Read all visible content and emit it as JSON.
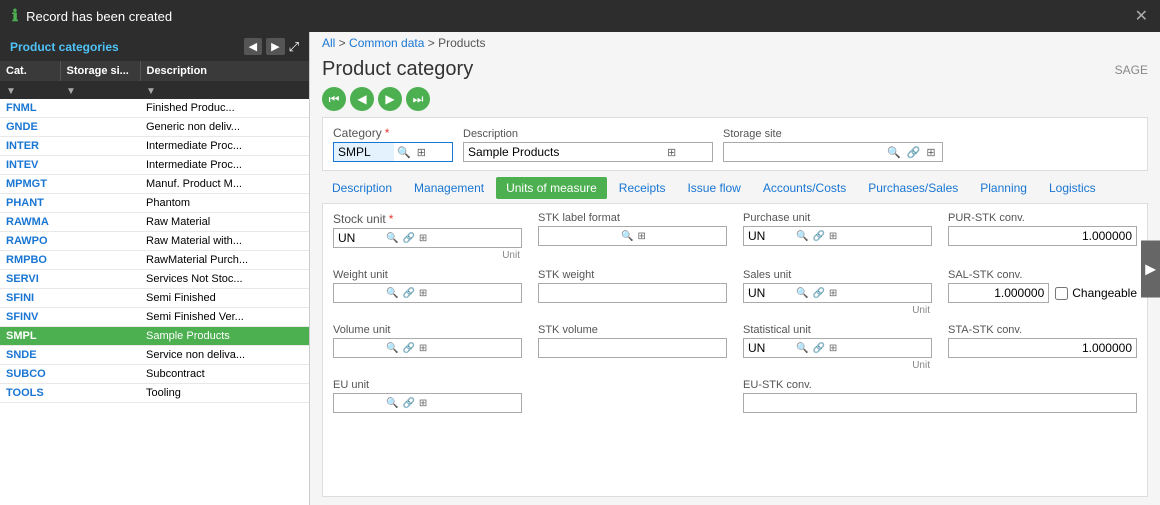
{
  "notification": {
    "icon": "ℹ",
    "text": "Record has been created",
    "close_icon": "✕"
  },
  "left_panel": {
    "title": "Product categories",
    "columns": [
      "Cat.",
      "Storage si...",
      "Description"
    ],
    "rows": [
      {
        "cat": "FNML",
        "storage": "",
        "description": "Finished Produc..."
      },
      {
        "cat": "GNDE",
        "storage": "",
        "description": "Generic non deliv..."
      },
      {
        "cat": "INTER",
        "storage": "",
        "description": "Intermediate Proc..."
      },
      {
        "cat": "INTEV",
        "storage": "",
        "description": "Intermediate Proc..."
      },
      {
        "cat": "MPMGT",
        "storage": "",
        "description": "Manuf. Product M..."
      },
      {
        "cat": "PHANT",
        "storage": "",
        "description": "Phantom"
      },
      {
        "cat": "RAWMA",
        "storage": "",
        "description": "Raw Material"
      },
      {
        "cat": "RAWPO",
        "storage": "",
        "description": "Raw Material with..."
      },
      {
        "cat": "RMPBO",
        "storage": "",
        "description": "RawMaterial Purch..."
      },
      {
        "cat": "SERVI",
        "storage": "",
        "description": "Services Not Stoc..."
      },
      {
        "cat": "SFINI",
        "storage": "",
        "description": "Semi Finished"
      },
      {
        "cat": "SFINV",
        "storage": "",
        "description": "Semi Finished Ver..."
      },
      {
        "cat": "SMPL",
        "storage": "",
        "description": "Sample Products",
        "selected": true
      },
      {
        "cat": "SNDE",
        "storage": "",
        "description": "Service non deliva..."
      },
      {
        "cat": "SUBCO",
        "storage": "",
        "description": "Subcontract"
      },
      {
        "cat": "TOOLS",
        "storage": "",
        "description": "Tooling"
      }
    ]
  },
  "breadcrumb": {
    "all": "All",
    "separator1": " > ",
    "common_data": "Common data",
    "separator2": " > ",
    "products": "Products"
  },
  "page": {
    "title": "Product category",
    "sage_label": "SAGE"
  },
  "form": {
    "category_label": "Category",
    "category_value": "SMPL",
    "description_label": "Description",
    "description_value": "Sample Products",
    "storage_site_label": "Storage site",
    "storage_site_value": ""
  },
  "tabs": [
    {
      "label": "Description",
      "active": false
    },
    {
      "label": "Management",
      "active": false
    },
    {
      "label": "Units of measure",
      "active": true
    },
    {
      "label": "Receipts",
      "active": false
    },
    {
      "label": "Issue flow",
      "active": false
    },
    {
      "label": "Accounts/Costs",
      "active": false
    },
    {
      "label": "Purchases/Sales",
      "active": false
    },
    {
      "label": "Planning",
      "active": false
    },
    {
      "label": "Logistics",
      "active": false
    }
  ],
  "units_fields": {
    "stock_unit_label": "Stock unit",
    "stock_unit_value": "UN",
    "stk_label_format_label": "STK label format",
    "stk_label_format_value": "",
    "purchase_unit_label": "Purchase unit",
    "purchase_unit_value": "UN",
    "pur_stk_conv_label": "PUR-STK conv.",
    "pur_stk_conv_value": "1.000000",
    "unit_label1": "Unit",
    "unit_label2": "Unit",
    "weight_unit_label": "Weight unit",
    "weight_unit_value": "",
    "stk_weight_label": "STK weight",
    "stk_weight_value": "",
    "sales_unit_label": "Sales unit",
    "sales_unit_value": "UN",
    "sal_stk_conv_label": "SAL-STK conv.",
    "sal_stk_conv_value": "1.000000",
    "changeable_label": "Changeable",
    "unit_label3": "Unit",
    "volume_unit_label": "Volume unit",
    "volume_unit_value": "",
    "stk_volume_label": "STK volume",
    "stk_volume_value": "",
    "statistical_unit_label": "Statistical unit",
    "statistical_unit_value": "UN",
    "sta_stk_conv_label": "STA-STK conv.",
    "sta_stk_conv_value": "1.000000",
    "unit_label4": "Unit",
    "eu_unit_label": "EU unit",
    "eu_stk_conv_label": "EU-STK conv."
  }
}
